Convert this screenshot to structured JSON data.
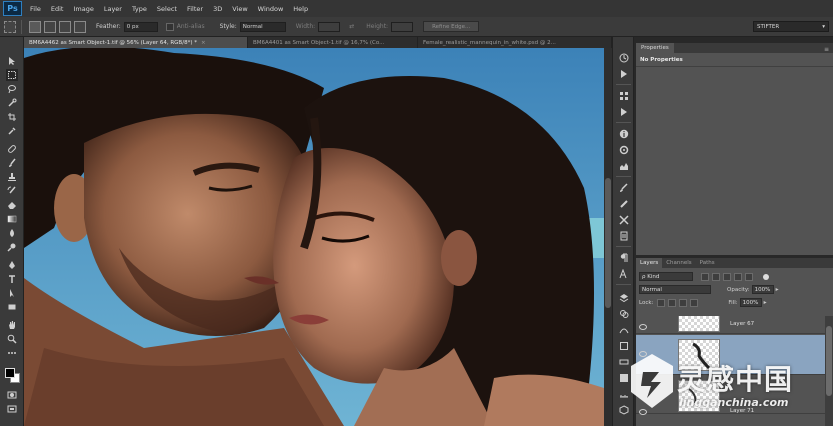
{
  "app": {
    "logo": "Ps"
  },
  "menu": [
    "File",
    "Edit",
    "Image",
    "Layer",
    "Type",
    "Select",
    "Filter",
    "3D",
    "View",
    "Window",
    "Help"
  ],
  "options": {
    "feather_label": "Feather:",
    "feather_value": "0 px",
    "antialias_label": "Anti-alias",
    "style_label": "Style:",
    "style_value": "Normal",
    "width_label": "Width:",
    "height_label": "Height:",
    "refine_edge": "Refine Edge...",
    "workspace": "STIFTER"
  },
  "tabs": [
    {
      "label": "BM6A4462 as Smart Object-1.tif @ 56% (Layer 64, RGB/8*) *",
      "active": true
    },
    {
      "label": "BM6A4401 as Smart Object-1.tif @ 16,7% (Co...",
      "active": false
    },
    {
      "label": "Female_realistic_mannequin_in_white.psd @ 2...",
      "active": false
    }
  ],
  "properties": {
    "tab": "Properties",
    "message": "No Properties"
  },
  "layers": {
    "tabs": [
      "Layers",
      "Channels",
      "Paths"
    ],
    "kind": "ρ Kind",
    "blend_mode": "Normal",
    "opacity_label": "Opacity:",
    "opacity_value": "100%",
    "lock_label": "Lock:",
    "fill_label": "Fill:",
    "fill_value": "100%",
    "items": [
      {
        "name": "Layer 67",
        "selected": false
      },
      {
        "name": "",
        "selected": true
      },
      {
        "name": "Layer 71",
        "selected": false
      }
    ]
  },
  "watermark": {
    "cn": "灵感中国",
    "url": "lingganchina.com"
  },
  "colors": {
    "accent": "#2e7fc0",
    "selection": "#8aa4c0",
    "panel": "#535353"
  }
}
